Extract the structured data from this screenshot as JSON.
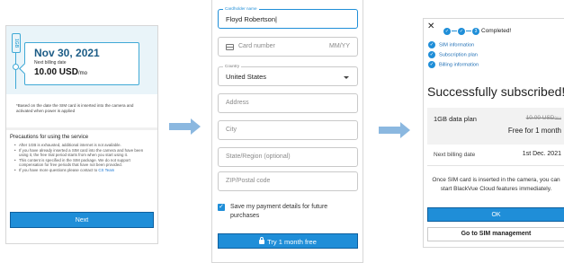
{
  "colors": {
    "accent": "#1f8ed8",
    "arrow": "#8bb8e0",
    "hero_bg": "#e9f4f9"
  },
  "screen1": {
    "gb_tag": "1GB",
    "billing_date": "Nov 30, 2021",
    "billing_label": "Next billing date",
    "amount": "10.00 USD",
    "amount_unit": "/mo",
    "note": "*Based on the date the SIM card is inserted into the camera and activated when power is applied",
    "precautions_title": "Precautions for using the service",
    "precautions": [
      "After 1GB is exhausted, additional internet is not available.",
      "If you have already inserted a SIM card into the camera and have been using it, the free trial period starts from when you start using it.",
      "This content is specified in the SIM package. We do not support compensation for free periods that have not been provided."
    ],
    "precaution_last_prefix": "If you have more questions please contact to ",
    "precaution_last_link": "CS Team",
    "next_button": "Next"
  },
  "screen2": {
    "cardholder_label": "Cardholder name",
    "cardholder_value": "Floyd Robertson|",
    "card_number_placeholder": "Card number",
    "mmyy_placeholder": "MM/YY",
    "country_label": "Country",
    "country_value": "United States",
    "address_placeholder": "Address",
    "city_placeholder": "City",
    "state_placeholder": "State/Region (optional)",
    "zip_placeholder": "ZIP/Postal code",
    "save_checkbox_label": "Save my payment details for future purchases",
    "try_button": "Try 1 month free"
  },
  "screen3": {
    "step3_number": "3",
    "completed_label": "Completed!",
    "done_steps": [
      "SIM information",
      "Subscription plan",
      "Billing information"
    ],
    "title": "Successfully subscribed!",
    "plan_name": "1GB data plan",
    "plan_old_price": "10.00 USD",
    "plan_old_unit": "/mo",
    "plan_free_text": "Free for 1 month",
    "next_billing_label": "Next billing date",
    "next_billing_value": "1st Dec. 2021",
    "message": "Once SIM card is inserted in the camera, you can start BlackVue Cloud features immediately.",
    "ok_button": "OK",
    "sim_button": "Go to SIM management"
  }
}
